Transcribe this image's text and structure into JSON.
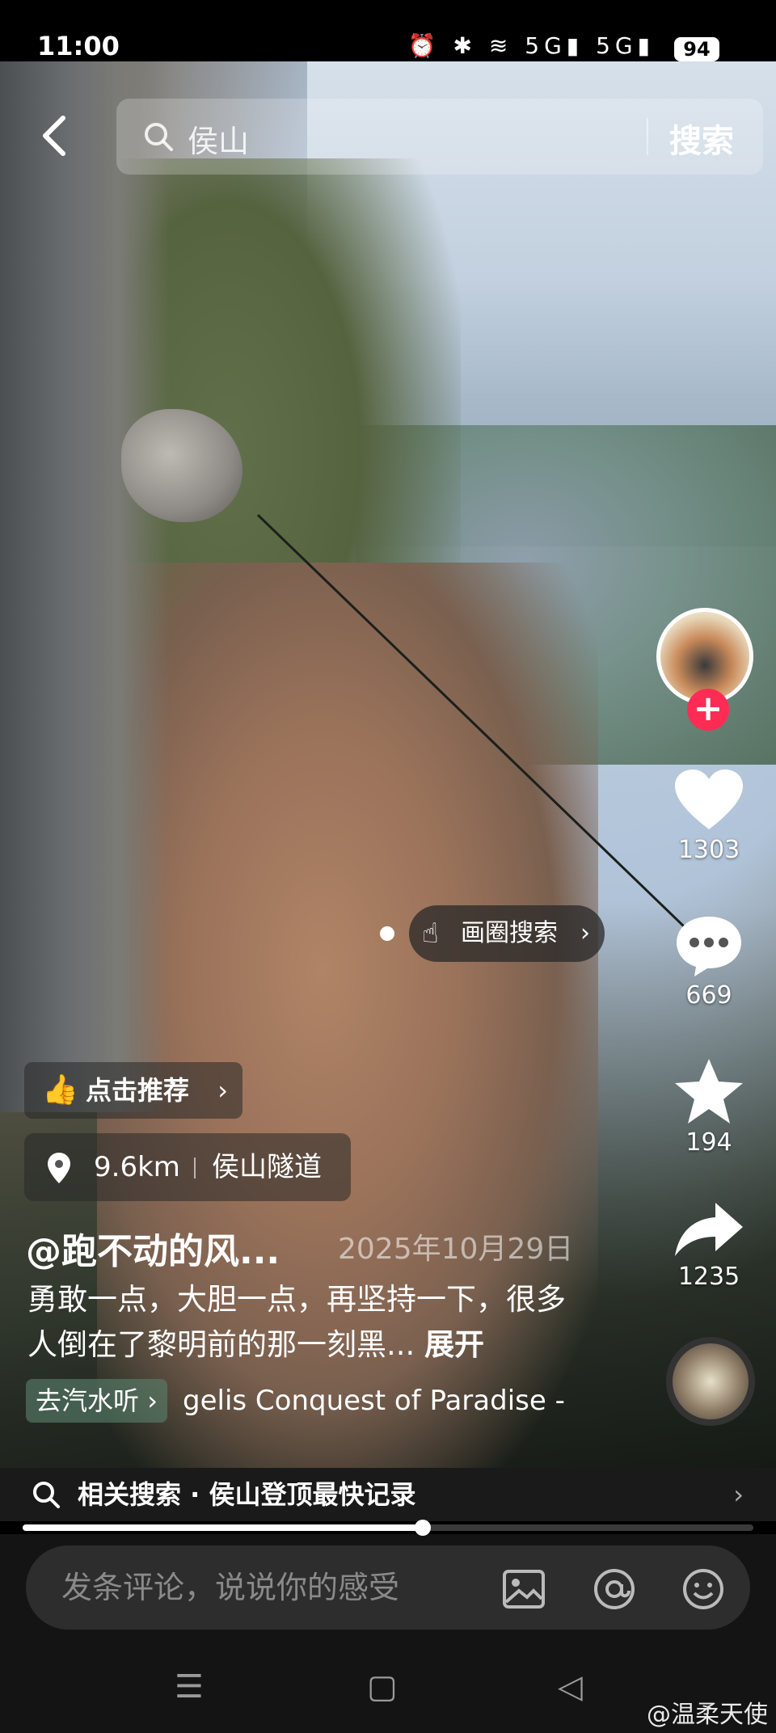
{
  "status": {
    "time": "11:00",
    "battery": "94",
    "icons_text": "⏰ ✱ ≋ 5G▮ 5G▮"
  },
  "search": {
    "query": "侯山",
    "button": "搜索"
  },
  "side": {
    "likes": "1303",
    "comments": "669",
    "favorites": "194",
    "shares": "1235"
  },
  "circle_search": {
    "label": "画圈搜索"
  },
  "recommend": {
    "label": "点击推荐"
  },
  "location": {
    "distance": "9.6km",
    "name": "侯山隧道"
  },
  "post": {
    "author": "@跑不动的风...",
    "date": "2025年10月29日",
    "description": "勇敢一点，大胆一点，再坚持一下，很多人倒在了黎明前的那一刻黑...",
    "more": "展开"
  },
  "music": {
    "tag": "去汽水听",
    "track": "gelis    Conquest of Paradise -"
  },
  "related": {
    "label": "相关搜索 · 侯山登顶最快记录"
  },
  "progress": {
    "fraction": 0.548
  },
  "comment": {
    "placeholder": "发条评论，说说你的感受"
  },
  "watermark": {
    "text": "@温柔天使"
  },
  "colors": {
    "accent": "#fe2c55",
    "background": "#000000"
  },
  "icons": [
    "back-icon",
    "search-icon",
    "heart-icon",
    "comment-icon",
    "star-icon",
    "share-icon",
    "pin-icon",
    "thumbs-up-icon",
    "hand-icon",
    "image-icon",
    "at-icon",
    "emoji-icon"
  ]
}
